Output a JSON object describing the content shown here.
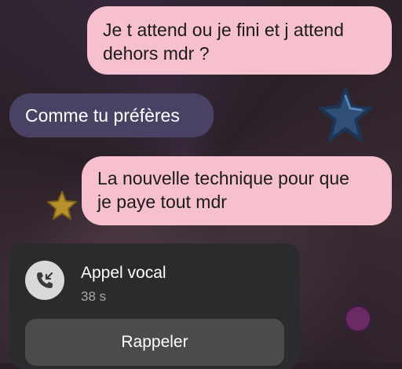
{
  "messages": [
    {
      "direction": "sent",
      "text": "Je t attend ou je fini et j attend\ndehors mdr ?"
    },
    {
      "direction": "received",
      "text": "Comme tu préfères"
    },
    {
      "direction": "sent",
      "text": "La nouvelle technique pour que\nje paye tout mdr"
    }
  ],
  "call": {
    "icon": "incoming-call-icon",
    "title": "Appel vocal",
    "duration": "38 s",
    "button_label": "Rappeler"
  },
  "stickers": [
    "blue-star-sticker",
    "yellow-star-sticker",
    "purple-dot-sticker"
  ],
  "colors": {
    "sent_bubble": "#f7c0cf",
    "received_bubble": "#4a4264",
    "call_card": "#2b2b2d",
    "button": "#4b4b4d"
  }
}
